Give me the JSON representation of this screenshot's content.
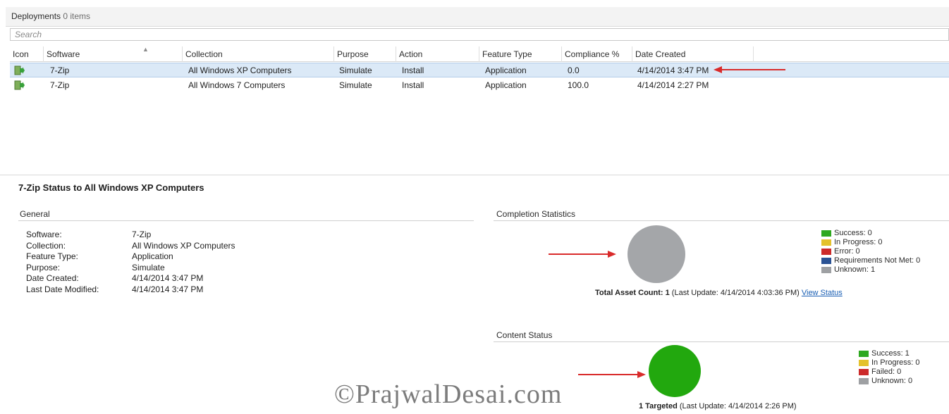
{
  "header": {
    "title": "Deployments",
    "count": "0 items"
  },
  "search": {
    "placeholder": "Search"
  },
  "columns": [
    "Icon",
    "Software",
    "Collection",
    "Purpose",
    "Action",
    "Feature Type",
    "Compliance %",
    "Date Created"
  ],
  "rows": [
    {
      "software": "7-Zip",
      "collection": "All Windows XP Computers",
      "purpose": "Simulate",
      "action": "Install",
      "feature_type": "Application",
      "compliance": "0.0",
      "date_created": "4/14/2014 3:47 PM",
      "selected": true
    },
    {
      "software": "7-Zip",
      "collection": "All Windows 7 Computers",
      "purpose": "Simulate",
      "action": "Install",
      "feature_type": "Application",
      "compliance": "100.0",
      "date_created": "4/14/2014 2:27 PM",
      "selected": false
    }
  ],
  "details": {
    "title": "7-Zip Status to All Windows XP Computers",
    "general": {
      "heading": "General",
      "labels": [
        "Software:",
        "Collection:",
        "Feature Type:",
        "Purpose:",
        "Date Created:",
        "Last Date Modified:"
      ],
      "values": [
        "7-Zip",
        "All Windows XP Computers",
        "Application",
        "Simulate",
        "4/14/2014 3:47 PM",
        "4/14/2014 3:47 PM"
      ]
    },
    "completion": {
      "heading": "Completion Statistics",
      "legend": [
        {
          "label": "Success: 0",
          "color": "#2ea81f"
        },
        {
          "label": "In Progress: 0",
          "color": "#e4c22c"
        },
        {
          "label": "Error: 0",
          "color": "#cc2a2a"
        },
        {
          "label": "Requirements Not Met: 0",
          "color": "#2a5294"
        },
        {
          "label": "Unknown: 1",
          "color": "#9ea0a3"
        }
      ],
      "pie_color": "#a4a6a9",
      "summary_bold": "Total Asset Count: 1",
      "summary_text": " (Last Update: 4/14/2014 4:03:36 PM) ",
      "link": "View Status"
    },
    "content": {
      "heading": "Content Status",
      "legend": [
        {
          "label": "Success: 1",
          "color": "#2ea81f"
        },
        {
          "label": "In Progress: 0",
          "color": "#e4c22c"
        },
        {
          "label": "Failed: 0",
          "color": "#cc2a2a"
        },
        {
          "label": "Unknown: 0",
          "color": "#9ea0a3"
        }
      ],
      "pie_color": "#22a80e",
      "summary_bold": "1 Targeted",
      "summary_text": " (Last Update: 4/14/2014 2:26 PM)"
    }
  },
  "watermark": "©PrajwalDesai.com",
  "colors": {
    "annotation_arrow": "#d92b2b",
    "selection": "#dbe9f7"
  }
}
